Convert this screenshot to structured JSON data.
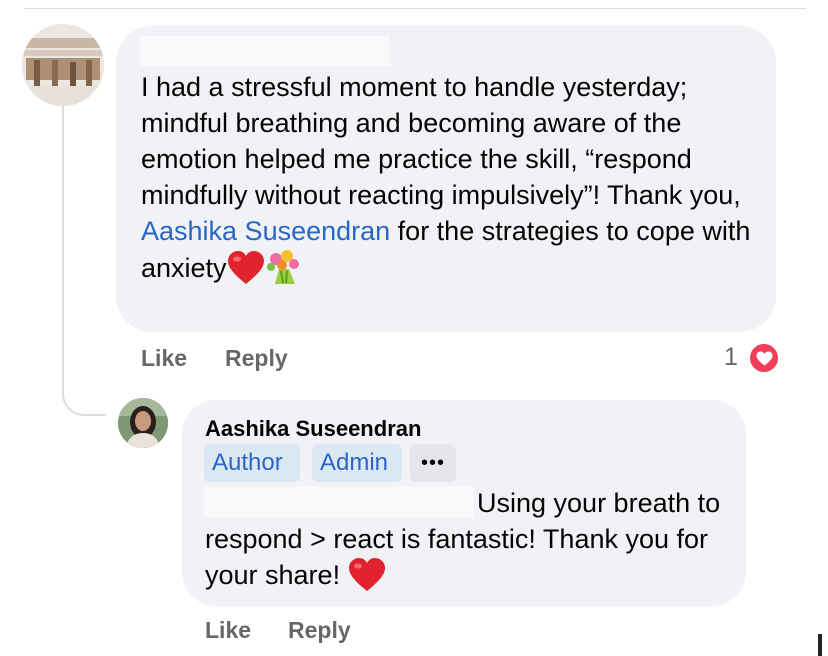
{
  "comment": {
    "text_before_mention": "I had a stressful moment to handle yesterday; mindful breathing and becoming aware of the emotion helped me practice the skill, “respond mindfully without reacting impulsively”! Thank you, ",
    "mention": "Aashika Suseendran",
    "text_after_mention": " for the strategies to cope with anxiety",
    "emojis": [
      "red-heart",
      "bouquet"
    ],
    "like_label": "Like",
    "reply_label": "Reply",
    "reaction_count": "1",
    "reaction_icon": "love-reaction"
  },
  "reply": {
    "author_name": "Aashika Suseendran",
    "badges": [
      "Author",
      "Admin"
    ],
    "more_label": "•••",
    "text": "Using your breath to respond > react is fantastic! Thank you for your share! ",
    "emoji": "red-heart",
    "like_label": "Like",
    "reply_label": "Reply"
  },
  "colors": {
    "bubble": "#f0f2f5",
    "link": "#2a66c6",
    "badge_bg": "#dbe7f2",
    "action_text": "#65676b",
    "love_reaction": "#f33e58",
    "heart": "#e0232e"
  }
}
